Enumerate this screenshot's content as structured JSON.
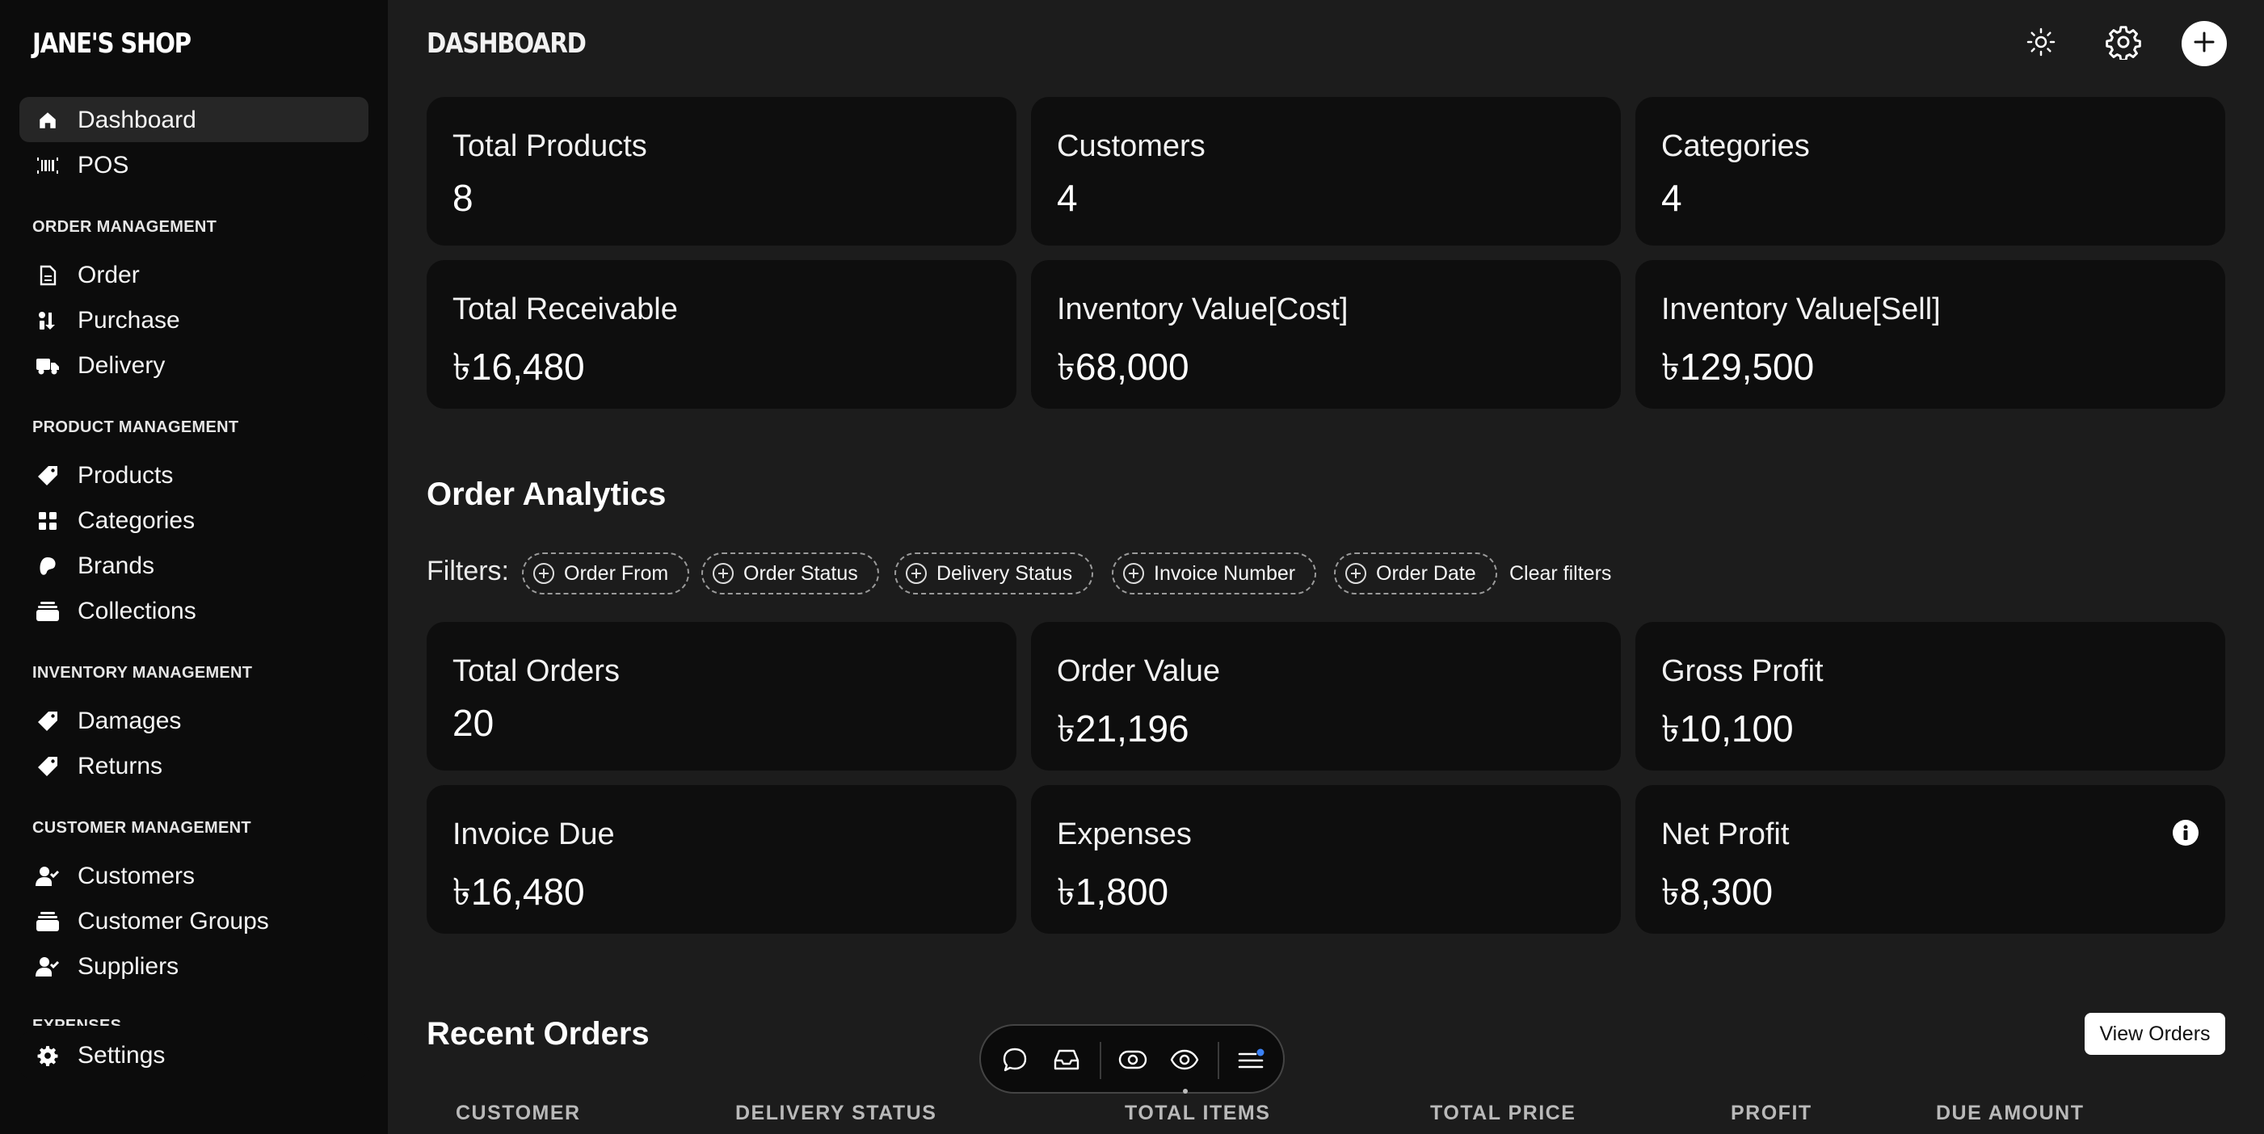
{
  "app": {
    "brand": "JANE'S SHOP"
  },
  "header": {
    "title": "DASHBOARD"
  },
  "sidebar": {
    "items": [
      {
        "label": "Dashboard",
        "icon": "home-icon"
      },
      {
        "label": "POS",
        "icon": "barcode-icon"
      },
      {
        "label": "Order",
        "icon": "document-icon"
      },
      {
        "label": "Purchase",
        "icon": "purchase-icon"
      },
      {
        "label": "Delivery",
        "icon": "truck-icon"
      },
      {
        "label": "Products",
        "icon": "tag-icon"
      },
      {
        "label": "Categories",
        "icon": "grid-icon"
      },
      {
        "label": "Brands",
        "icon": "palette-icon"
      },
      {
        "label": "Collections",
        "icon": "stack-icon"
      },
      {
        "label": "Damages",
        "icon": "tag-icon"
      },
      {
        "label": "Returns",
        "icon": "tag-icon"
      },
      {
        "label": "Customers",
        "icon": "user-icon"
      },
      {
        "label": "Customer Groups",
        "icon": "stack-icon"
      },
      {
        "label": "Suppliers",
        "icon": "user-icon"
      },
      {
        "label": "Settings",
        "icon": "gear-icon"
      }
    ],
    "sections": {
      "order": "ORDER MANAGEMENT",
      "product": "PRODUCT MANAGEMENT",
      "inventory": "INVENTORY MANAGEMENT",
      "customer": "CUSTOMER MANAGEMENT",
      "expenses": "EXPENSES"
    }
  },
  "stats": [
    {
      "label": "Total Products",
      "value": "8"
    },
    {
      "label": "Customers",
      "value": "4"
    },
    {
      "label": "Categories",
      "value": "4"
    },
    {
      "label": "Total Receivable",
      "value": "৳16,480"
    },
    {
      "label": "Inventory Value[Cost]",
      "value": "৳68,000"
    },
    {
      "label": "Inventory Value[Sell]",
      "value": "৳129,500"
    }
  ],
  "analytics": {
    "title": "Order Analytics",
    "filters_label": "Filters:",
    "filters": [
      "Order From",
      "Order Status",
      "Delivery Status",
      "Invoice Number",
      "Order Date"
    ],
    "clear_label": "Clear filters",
    "cards": [
      {
        "label": "Total Orders",
        "value": "20"
      },
      {
        "label": "Order Value",
        "value": "৳21,196"
      },
      {
        "label": "Gross Profit",
        "value": "৳10,100"
      },
      {
        "label": "Invoice Due",
        "value": "৳16,480"
      },
      {
        "label": "Expenses",
        "value": "৳1,800"
      },
      {
        "label": "Net Profit",
        "value": "৳8,300"
      }
    ]
  },
  "recent_orders": {
    "title": "Recent Orders",
    "view_label": "View Orders",
    "columns": [
      "CUSTOMER",
      "DELIVERY STATUS",
      "TOTAL ITEMS",
      "TOTAL PRICE",
      "PROFIT",
      "DUE AMOUNT"
    ]
  },
  "colors": {
    "background": "#1c1c1c",
    "sidebar": "#0c0c0c",
    "card": "#0e0e0e",
    "accent": "#3b82f6"
  }
}
